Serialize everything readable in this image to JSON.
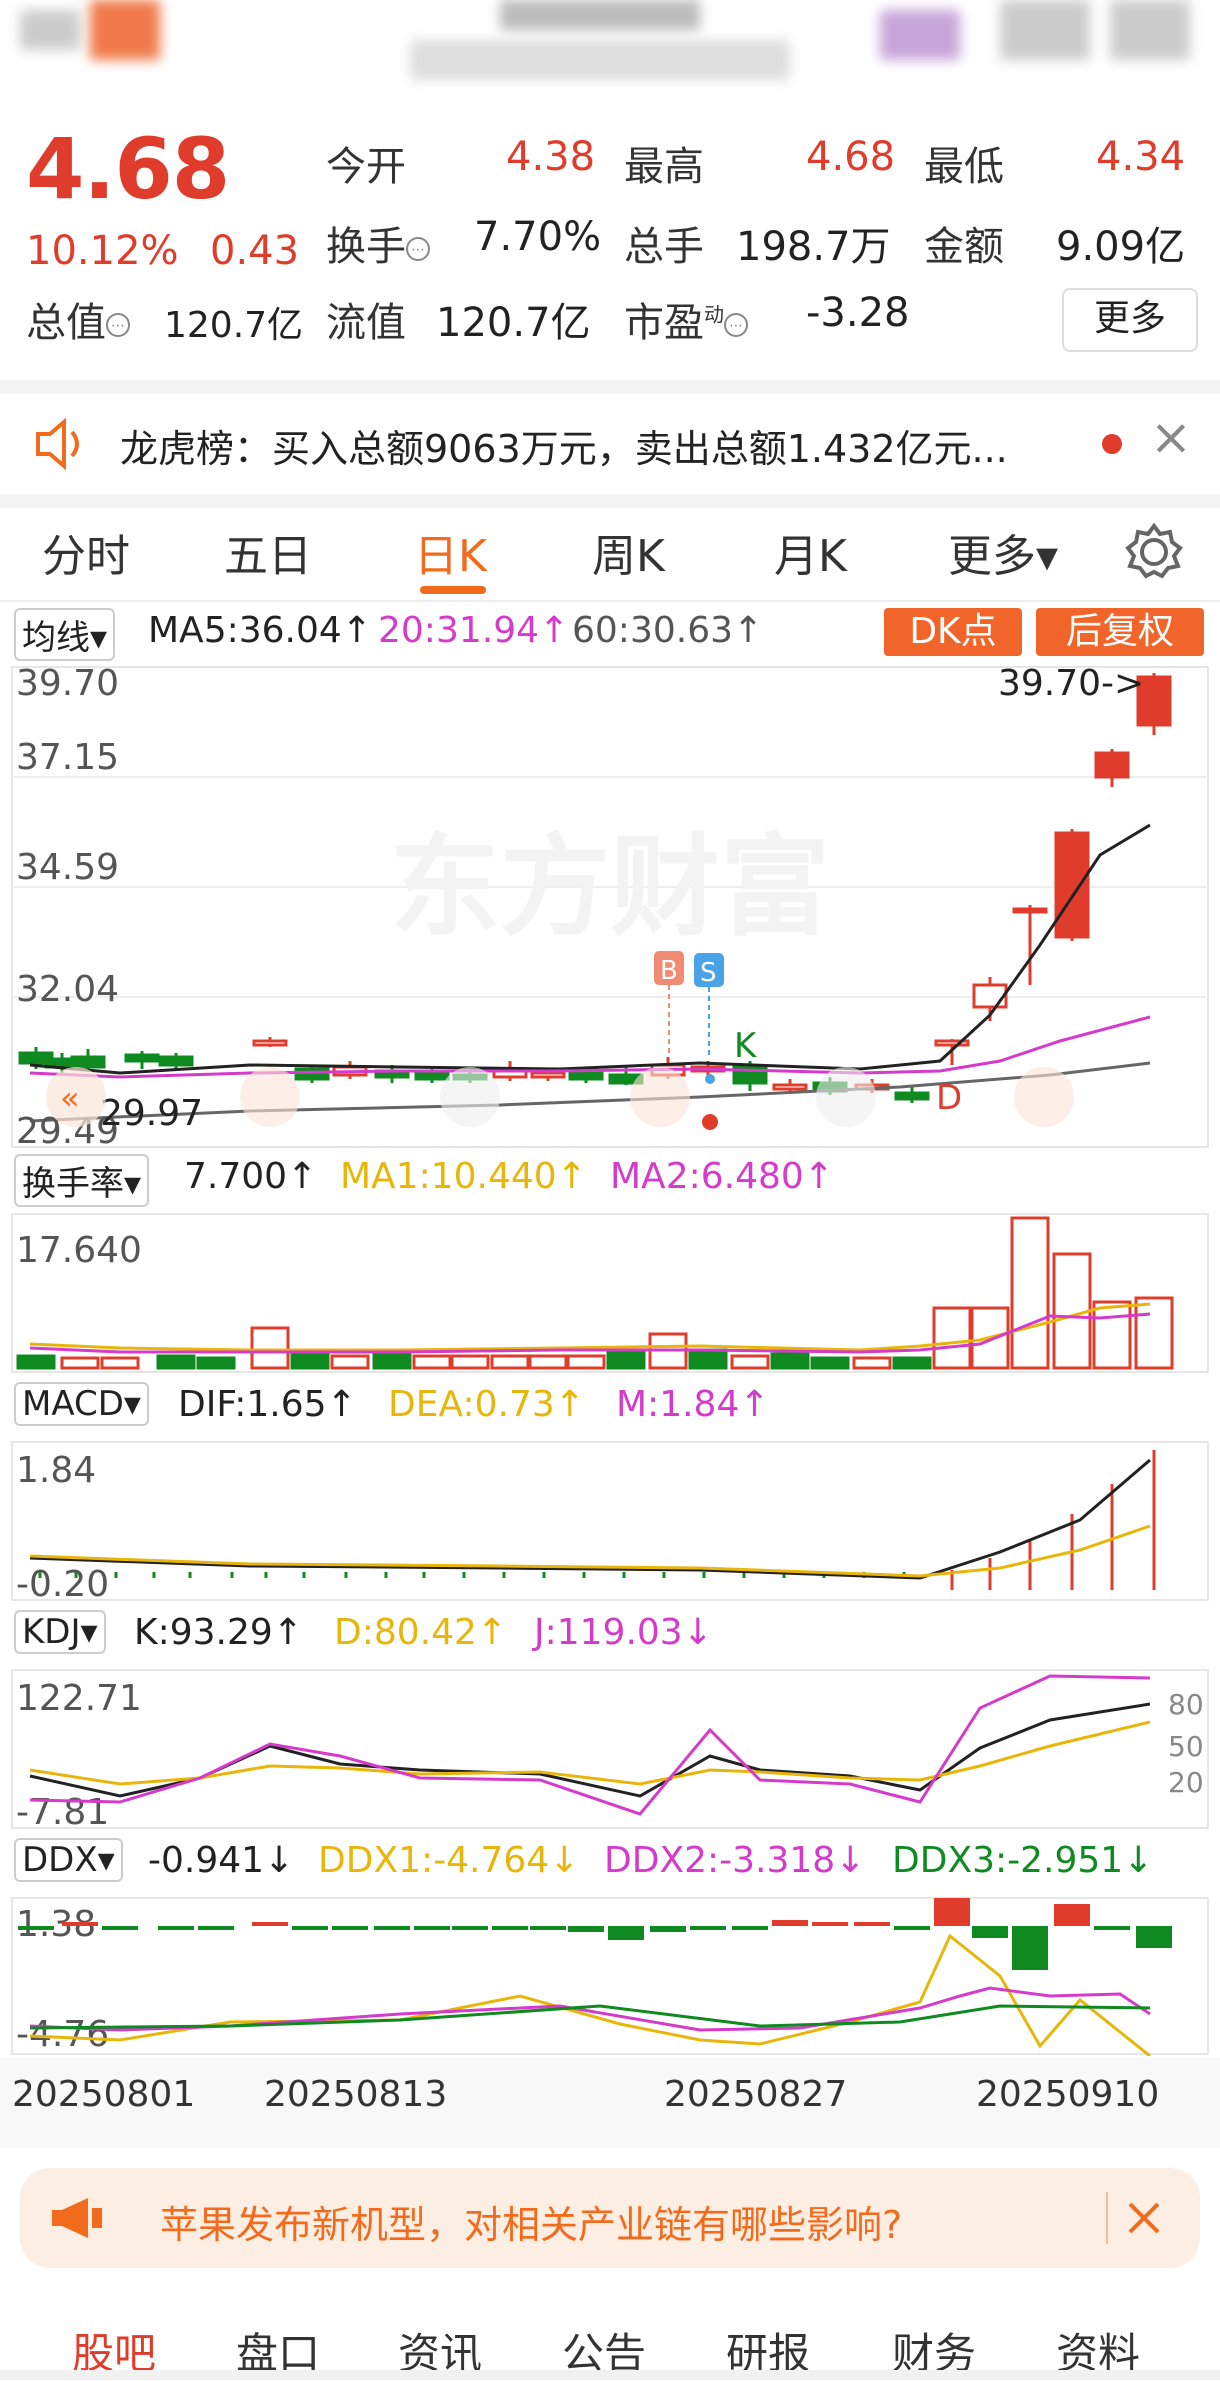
{
  "quote": {
    "price": "4.68",
    "change_pct": "10.12%",
    "change_abs": "0.43",
    "open_label": "今开",
    "open": "4.38",
    "high_label": "最高",
    "high": "4.68",
    "low_label": "最低",
    "low": "4.34",
    "turnover_label": "换手",
    "turnover": "7.70%",
    "volume_label": "总手",
    "volume": "198.7万",
    "amount_label": "金额",
    "amount": "9.09亿",
    "mktcap_label": "总值",
    "mktcap": "120.7亿",
    "float_label": "流值",
    "float_cap": "120.7亿",
    "pe_label": "市盈",
    "pe_sup": "动",
    "pe": "-3.28",
    "more_label": "更多"
  },
  "notice": {
    "text": "龙虎榜：买入总额9063万元，卖出总额1.432亿元...",
    "close_icon": "×"
  },
  "tabs": [
    {
      "label": "分时"
    },
    {
      "label": "五日"
    },
    {
      "label": "日K"
    },
    {
      "label": "周K"
    },
    {
      "label": "月K"
    },
    {
      "label": "更多▾"
    }
  ],
  "ma": {
    "selector": "均线▾",
    "ma5": "MA5:36.04↑",
    "ma20": "20:31.94↑",
    "ma60": "60:30.63↑",
    "dk_btn": "DK点",
    "adj_btn": "后复权"
  },
  "kline": {
    "ticks": [
      "39.70",
      "37.15",
      "34.59",
      "32.04",
      "29.49"
    ],
    "max_label": "39.70->",
    "min_label": "29.97",
    "watermark": "东方财富",
    "b_marker": "B",
    "s_marker": "S",
    "k_marker": "K",
    "d_marker": "D"
  },
  "turnover_ind": {
    "selector": "换手率▾",
    "value": "7.700↑",
    "ma1": "MA1:10.440↑",
    "ma2": "MA2:6.480↑",
    "tick": "17.640"
  },
  "macd": {
    "selector": "MACD▾",
    "dif": "DIF:1.65↑",
    "dea": "DEA:0.73↑",
    "m": "M:1.84↑",
    "tick_top": "1.84",
    "tick_bottom": "-0.20"
  },
  "kdj": {
    "selector": "KDJ▾",
    "k": "K:93.29↑",
    "d": "D:80.42↑",
    "j": "J:119.03↓",
    "tick_top": "122.71",
    "tick_bottom": "-7.81",
    "levels": [
      "80",
      "50",
      "20"
    ]
  },
  "ddx": {
    "selector": "DDX▾",
    "value": "-0.941↓",
    "ddx1": "DDX1:-4.764↓",
    "ddx2": "DDX2:-3.318↓",
    "ddx3": "DDX3:-2.951↓",
    "tick_top": "1.38",
    "tick_bottom": "-4.76"
  },
  "dates": [
    "20250801",
    "20250813",
    "20250827",
    "20250910"
  ],
  "banner": {
    "text": "苹果发布新机型，对相关产业链有哪些影响?"
  },
  "bottom_nav": [
    "股吧",
    "盘口",
    "资讯",
    "公告",
    "研报",
    "财务",
    "资料"
  ],
  "colors": {
    "up": "#e03c2c",
    "down": "#0f8a20",
    "accent": "#f26b1d"
  }
}
